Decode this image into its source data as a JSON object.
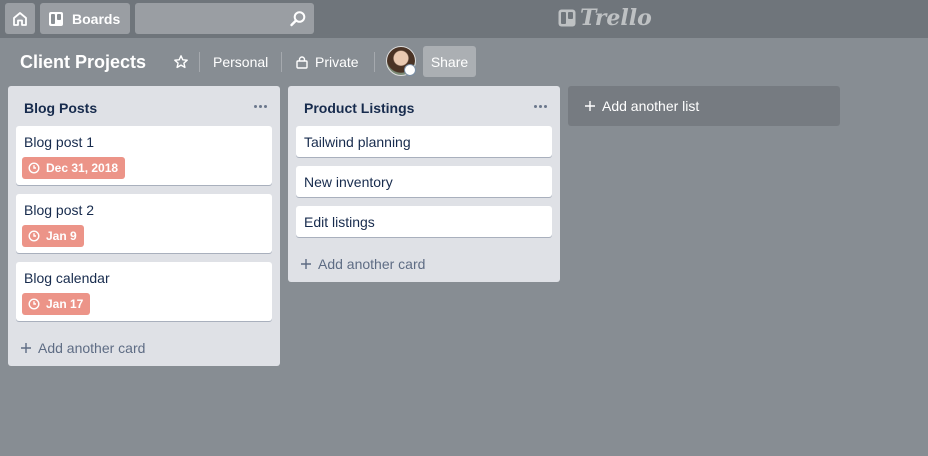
{
  "header": {
    "boards_label": "Boards",
    "search_value": "",
    "logo_text": "Trello"
  },
  "board": {
    "title": "Client Projects",
    "team_label": "Personal",
    "visibility_label": "Private",
    "share_label": "Share"
  },
  "lists": [
    {
      "title": "Blog Posts",
      "cards": [
        {
          "title": "Blog post 1",
          "due": "Dec 31, 2018"
        },
        {
          "title": "Blog post 2",
          "due": "Jan 9"
        },
        {
          "title": "Blog calendar",
          "due": "Jan 17"
        }
      ],
      "add_card_label": "Add another card"
    },
    {
      "title": "Product Listings",
      "cards": [
        {
          "title": "Tailwind planning"
        },
        {
          "title": "New inventory"
        },
        {
          "title": "Edit listings"
        }
      ],
      "add_card_label": "Add another card"
    }
  ],
  "add_list_label": "Add another list",
  "colors": {
    "background": "#878d93",
    "due_badge": "#ec9488",
    "list_bg": "#dfe1e6"
  }
}
